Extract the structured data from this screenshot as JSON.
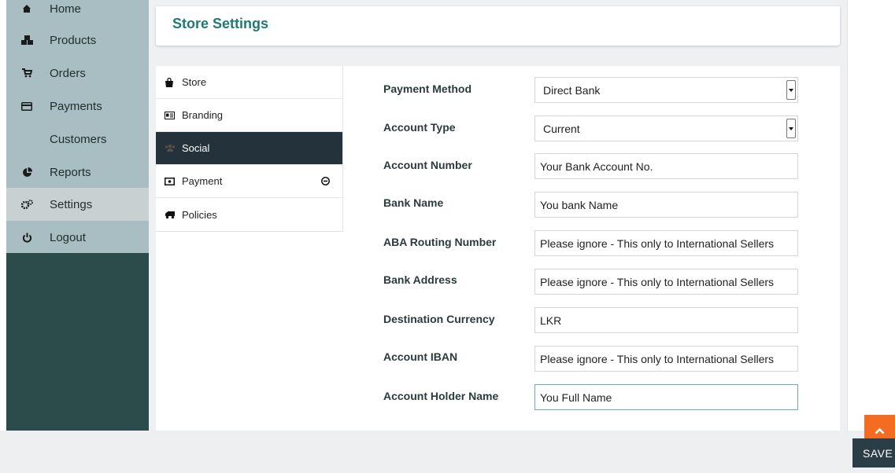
{
  "sidebar": {
    "items": [
      {
        "label": "Home",
        "icon": "home-icon"
      },
      {
        "label": "Products",
        "icon": "products-icon"
      },
      {
        "label": "Orders",
        "icon": "cart-icon"
      },
      {
        "label": "Payments",
        "icon": "credit-card-icon"
      },
      {
        "label": "Customers",
        "icon": ""
      },
      {
        "label": "Reports",
        "icon": "pie-chart-icon"
      },
      {
        "label": "Settings",
        "icon": "gears-icon"
      },
      {
        "label": "Logout",
        "icon": "power-icon"
      }
    ]
  },
  "header": {
    "title": "Store Settings"
  },
  "tabs": [
    {
      "label": "Store",
      "icon": "shopping-bag-icon"
    },
    {
      "label": "Branding",
      "icon": "id-card-icon"
    },
    {
      "label": "Social",
      "icon": "users-icon"
    },
    {
      "label": "Payment",
      "icon": "money-icon"
    },
    {
      "label": "Policies",
      "icon": "truck-icon"
    }
  ],
  "form": {
    "payment_method": {
      "label": "Payment Method",
      "value": "Direct Bank"
    },
    "account_type": {
      "label": "Account Type",
      "value": "Current"
    },
    "account_number": {
      "label": "Account Number",
      "placeholder": "Your Bank Account No."
    },
    "bank_name": {
      "label": "Bank Name",
      "placeholder": "You bank Name"
    },
    "aba_routing": {
      "label": "ABA Routing Number",
      "placeholder": "Please ignore - This only to International Sellers"
    },
    "bank_address": {
      "label": "Bank Address",
      "placeholder": "Please ignore - This only to International Sellers"
    },
    "destination_currency": {
      "label": "Destination Currency",
      "value": "LKR"
    },
    "account_iban": {
      "label": "Account IBAN",
      "placeholder": "Please ignore - This only to International Sellers"
    },
    "account_holder": {
      "label": "Account Holder Name",
      "placeholder": "You Full Name"
    }
  },
  "save_label": "SAVE",
  "colors": {
    "accent": "#1f7a73",
    "sidebar": "#a9bec2",
    "sidebar_dark": "#2c4c4b",
    "active_tab": "#23323b",
    "orange": "#f36c21"
  }
}
